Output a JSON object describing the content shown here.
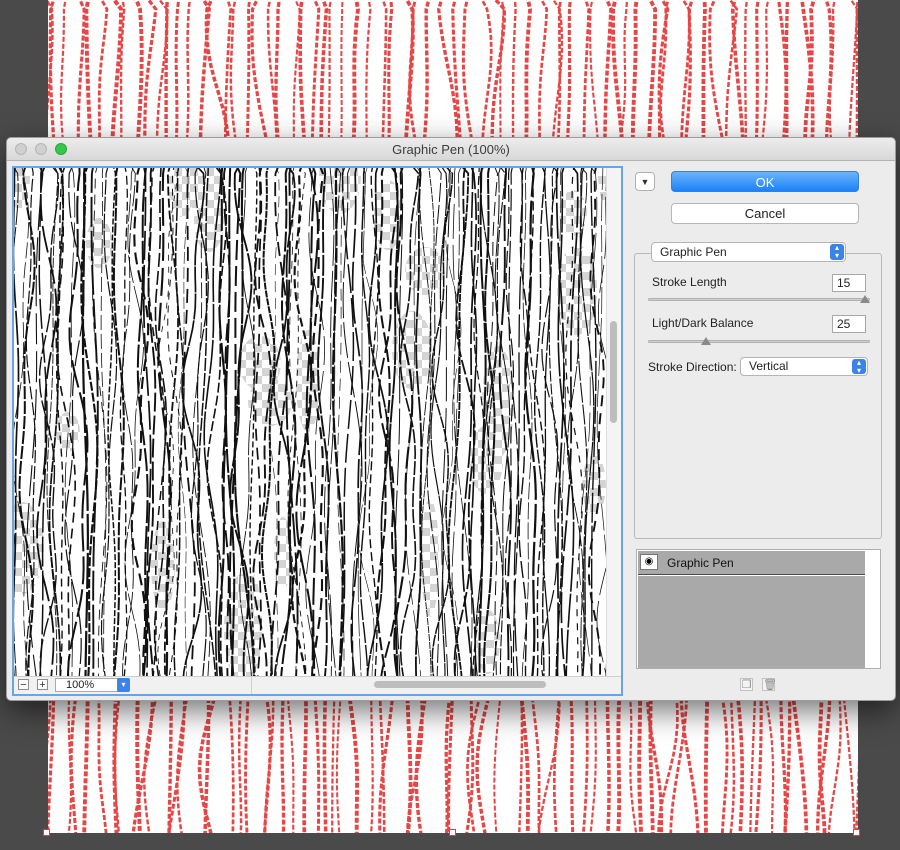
{
  "dialog": {
    "title": "Graphic Pen (100%)",
    "ok_label": "OK",
    "cancel_label": "Cancel",
    "collapse_icon": "chevron-down-icon"
  },
  "preview": {
    "zoom_value": "100%",
    "zoom_out_label": "−",
    "zoom_in_label": "+"
  },
  "filter": {
    "selected": "Graphic Pen",
    "stroke_length_label": "Stroke Length",
    "stroke_length_value": "15",
    "stroke_length_fraction": 1.0,
    "balance_label": "Light/Dark Balance",
    "balance_value": "25",
    "balance_fraction": 0.25,
    "direction_label": "Stroke Direction:",
    "direction_value": "Vertical"
  },
  "layers": {
    "items": [
      {
        "name": "Graphic Pen",
        "visible": true
      }
    ]
  },
  "colors": {
    "accent": "#1a82fb",
    "path_red": "#e64646",
    "canvas_bg": "#4a4a4a"
  }
}
